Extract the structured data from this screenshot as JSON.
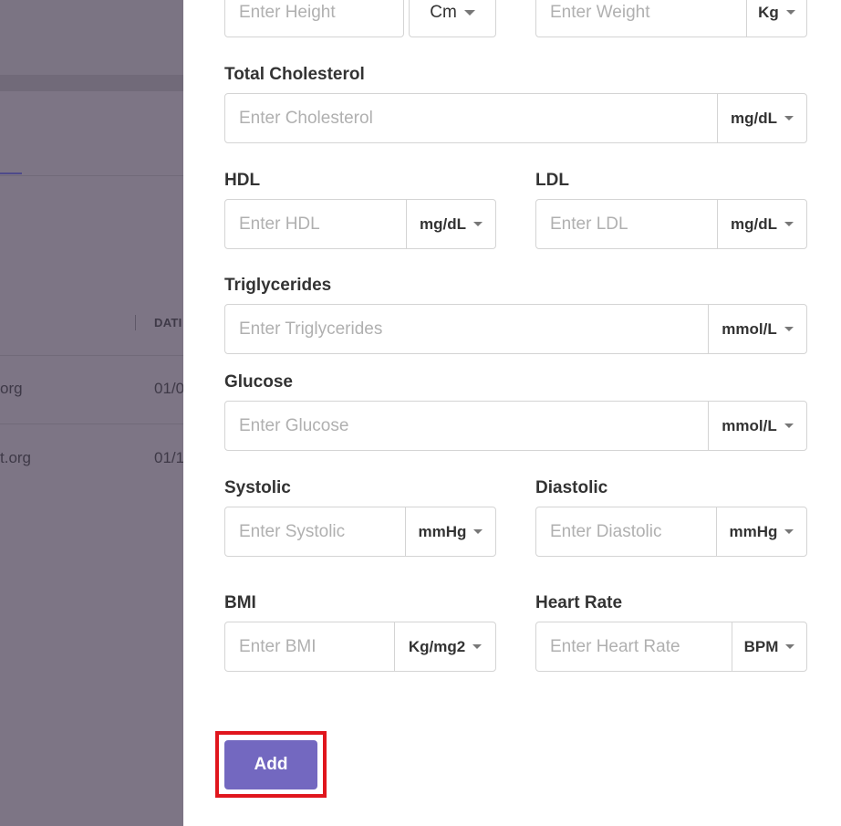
{
  "background_table": {
    "date_header_fragment": "DATI",
    "rows": [
      {
        "email_fragment": "org",
        "date_fragment": "01/0"
      },
      {
        "email_fragment": "t.org",
        "date_fragment": "01/1"
      }
    ]
  },
  "form": {
    "height": {
      "placeholder": "Enter Height",
      "unit": "Cm"
    },
    "weight": {
      "placeholder": "Enter Weight",
      "unit": "Kg"
    },
    "cholesterol": {
      "label": "Total Cholesterol",
      "placeholder": "Enter Cholesterol",
      "unit": "mg/dL"
    },
    "hdl": {
      "label": "HDL",
      "placeholder": "Enter HDL",
      "unit": "mg/dL"
    },
    "ldl": {
      "label": "LDL",
      "placeholder": "Enter LDL",
      "unit": "mg/dL"
    },
    "triglycerides": {
      "label": "Triglycerides",
      "placeholder": "Enter Triglycerides",
      "unit": "mmol/L"
    },
    "glucose": {
      "label": "Glucose",
      "placeholder": "Enter Glucose",
      "unit": "mmol/L"
    },
    "systolic": {
      "label": "Systolic",
      "placeholder": "Enter Systolic",
      "unit": "mmHg"
    },
    "diastolic": {
      "label": "Diastolic",
      "placeholder": "Enter Diastolic",
      "unit": "mmHg"
    },
    "bmi": {
      "label": "BMI",
      "placeholder": "Enter BMI",
      "unit": "Kg/mg2"
    },
    "heart_rate": {
      "label": "Heart Rate",
      "placeholder": "Enter Heart Rate",
      "unit": "BPM"
    },
    "add_label": "Add"
  },
  "colors": {
    "accent": "#7368c0",
    "highlight": "#e0161d",
    "overlay": "#7d7585"
  }
}
